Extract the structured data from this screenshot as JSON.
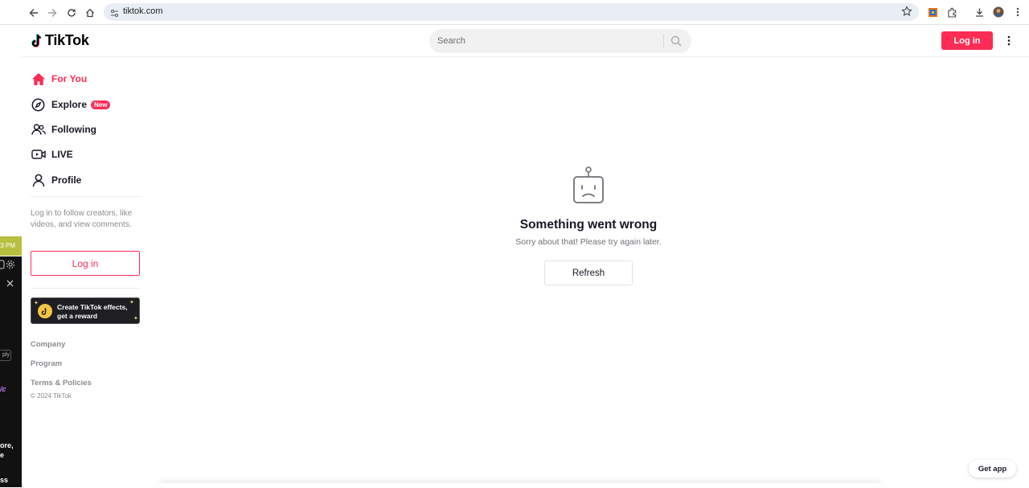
{
  "browser": {
    "url": "tiktok.com",
    "icons": [
      "back-icon",
      "forward-icon",
      "reload-icon",
      "home-icon",
      "site-settings-icon",
      "bookmark-star-icon",
      "extension-icon",
      "puzzle-icon",
      "download-icon",
      "profile-avatar",
      "menu-kebab-icon"
    ]
  },
  "side_window": {
    "time": "3 PM",
    "text1": "ply",
    "text2": "/c",
    "text3": "ore,",
    "text4": "e",
    "text5": "ss"
  },
  "header": {
    "logo_text": "TikTok",
    "search_placeholder": "Search",
    "login_label": "Log in"
  },
  "sidebar": {
    "items": [
      {
        "label": "For You",
        "icon": "home-icon",
        "active": true
      },
      {
        "label": "Explore",
        "icon": "compass-icon",
        "badge": "New"
      },
      {
        "label": "Following",
        "icon": "following-icon"
      },
      {
        "label": "LIVE",
        "icon": "live-icon"
      },
      {
        "label": "Profile",
        "icon": "profile-icon"
      }
    ],
    "login_hint": "Log in to follow creators, like videos, and view comments.",
    "login_label": "Log in",
    "effects_line1": "Create TikTok effects,",
    "effects_line2": "get a reward",
    "footer_links": [
      "Company",
      "Program",
      "Terms & Policies"
    ],
    "copyright": "© 2024 TikTok"
  },
  "main": {
    "error_title": "Something went wrong",
    "error_subtitle": "Sorry about that! Please try again later.",
    "refresh_label": "Refresh",
    "get_app_label": "Get app"
  },
  "colors": {
    "accent": "#fe2c55",
    "text": "#161823",
    "muted": "#8a8b91"
  }
}
